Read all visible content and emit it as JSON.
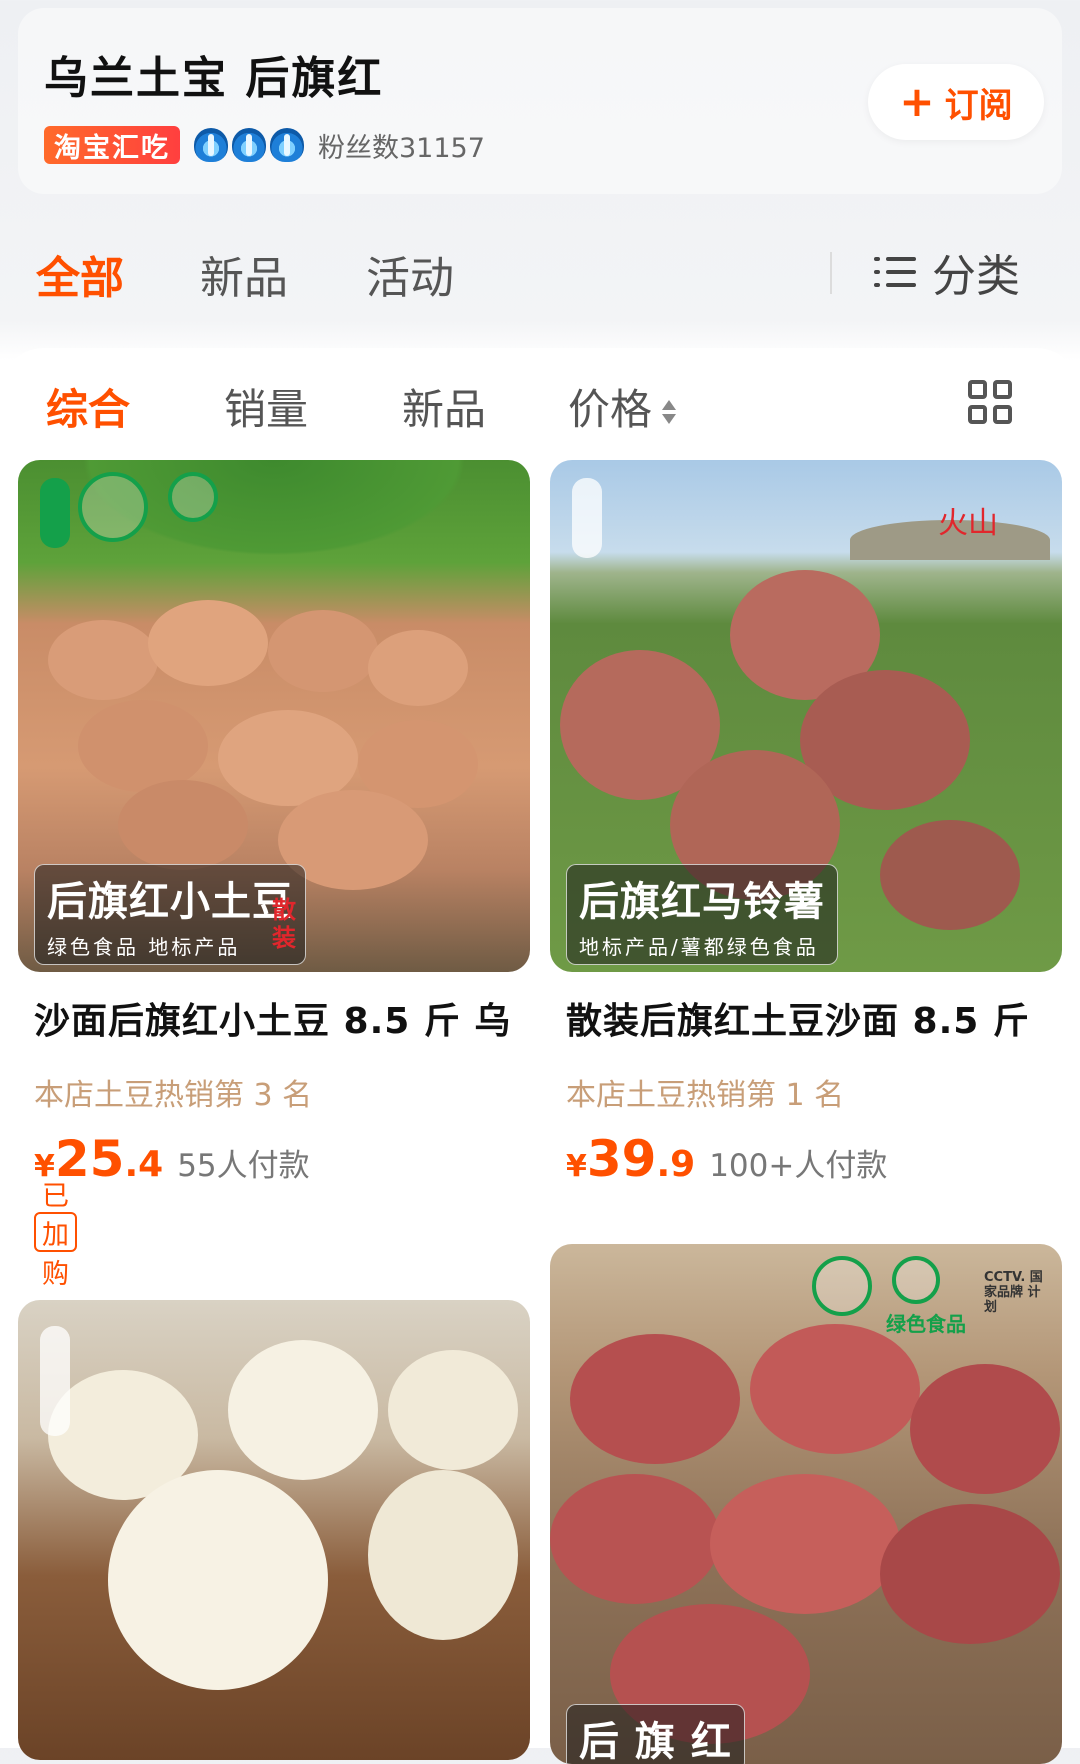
{
  "shop": {
    "name": "乌兰土宝 后旗红",
    "platform_badge": "淘宝汇吃",
    "crown_count": 3,
    "fans": "粉丝数31157",
    "subscribe_label": "订阅",
    "accent_color": "#ff5000"
  },
  "tabs": [
    {
      "label": "全部",
      "active": true
    },
    {
      "label": "新品",
      "active": false
    },
    {
      "label": "活动",
      "active": false
    }
  ],
  "category_label": "分类",
  "sort": [
    {
      "label": "综合",
      "active": true
    },
    {
      "label": "销量",
      "active": false
    },
    {
      "label": "新品",
      "active": false
    },
    {
      "label": "价格",
      "active": false
    }
  ],
  "products": [
    {
      "title": "沙面后旗红小土豆 8.5 斤 乌",
      "rank": "本店土豆热销第 3 名",
      "currency": "¥",
      "price_int": "25",
      "price_dec": ".4",
      "sales": "55人付款",
      "tag": "已加购",
      "photo": {
        "banner_title": "后旗红小土豆",
        "banner_sub": "绿色食品  地标产品",
        "side_tag": "散装"
      }
    },
    {
      "title": "散装后旗红土豆沙面 8.5 斤",
      "rank": "本店土豆热销第 1 名",
      "currency": "¥",
      "price_int": "39",
      "price_dec": ".9",
      "sales": "100+人付款",
      "photo": {
        "corner_text": "火山",
        "banner_title": "后旗红马铃薯",
        "banner_sub": "地标产品/薯都绿色食品"
      }
    },
    {
      "title": "",
      "photo": {}
    },
    {
      "title": "",
      "photo": {
        "logo_text": "绿色食品",
        "cctv_text": "CCTV. 国家品牌 计划",
        "banner_title": "后 旗 红"
      }
    }
  ]
}
